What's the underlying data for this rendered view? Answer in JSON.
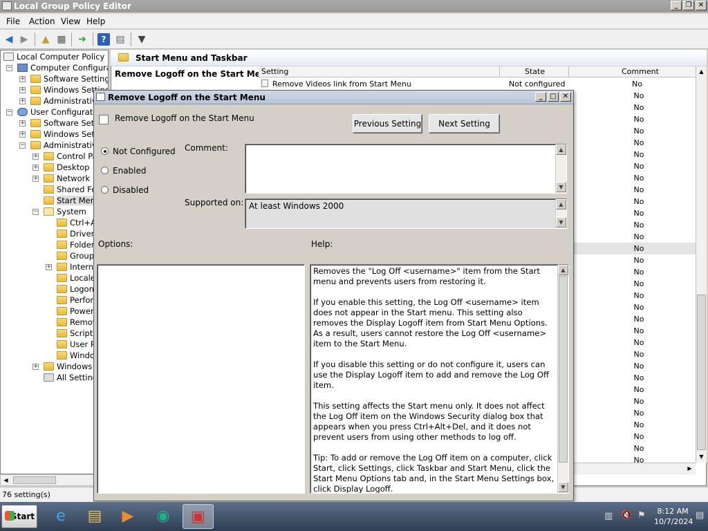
{
  "window": {
    "title": "Local Group Policy Editor"
  },
  "menu": [
    "File",
    "Action",
    "View",
    "Help"
  ],
  "tree": {
    "items": [
      {
        "label": "Local Computer Policy",
        "level": 0
      },
      {
        "label": "Computer Configuratio",
        "level": 1
      },
      {
        "label": "Software Settings",
        "level": 2
      },
      {
        "label": "Windows Settings",
        "level": 2
      },
      {
        "label": "Administrative",
        "level": 2
      },
      {
        "label": "User Configuration",
        "level": 1
      },
      {
        "label": "Software Setti",
        "level": 2
      },
      {
        "label": "Windows Setti",
        "level": 2
      },
      {
        "label": "Administrative",
        "level": 2
      },
      {
        "label": "Control Pa",
        "level": 3
      },
      {
        "label": "Desktop",
        "level": 3
      },
      {
        "label": "Network",
        "level": 3
      },
      {
        "label": "Shared Fo",
        "level": 3
      },
      {
        "label": "Start Menu",
        "level": 3
      },
      {
        "label": "System",
        "level": 3
      },
      {
        "label": "Ctrl+A",
        "level": 4
      },
      {
        "label": "Driver",
        "level": 4
      },
      {
        "label": "Folder",
        "level": 4
      },
      {
        "label": "Group",
        "level": 4
      },
      {
        "label": "Intern",
        "level": 4
      },
      {
        "label": "Locale",
        "level": 4
      },
      {
        "label": "Logon",
        "level": 4
      },
      {
        "label": "Perfor",
        "level": 4
      },
      {
        "label": "Power",
        "level": 4
      },
      {
        "label": "Remov",
        "level": 4
      },
      {
        "label": "Scripts",
        "level": 4
      },
      {
        "label": "User P",
        "level": 4
      },
      {
        "label": "Windo",
        "level": 4
      },
      {
        "label": "Windows C",
        "level": 3
      },
      {
        "label": "All Settings",
        "level": 3
      }
    ]
  },
  "right": {
    "folder_title": "Start Menu and Taskbar",
    "selected_policy": "Remove Logoff on the Start Menu",
    "columns": {
      "setting": "Setting",
      "state": "State",
      "comment": "Comment"
    },
    "first_row": {
      "setting": "Remove Videos link from Start Menu",
      "state": "Not configured",
      "comment": "No"
    },
    "comments": [
      "No",
      "No",
      "No",
      "No",
      "No",
      "No",
      "No",
      "No",
      "No",
      "No",
      "No",
      "No",
      "No",
      "No",
      "No",
      "No",
      "No",
      "No",
      "No",
      "No",
      "No",
      "No",
      "No",
      "No",
      "No",
      "No",
      "No",
      "No",
      "No",
      "No",
      "No",
      "No"
    ]
  },
  "status": {
    "text": "76 setting(s)"
  },
  "dialog": {
    "title": "Remove Logoff on the Start Menu",
    "policy_name": "Remove Logoff on the Start Menu",
    "prev_button": "Previous Setting",
    "next_button": "Next Setting",
    "radios": {
      "not_configured": "Not Configured",
      "enabled": "Enabled",
      "disabled": "Disabled"
    },
    "selected": "not_configured",
    "comment_label": "Comment:",
    "comment_value": "",
    "supported_label": "Supported on:",
    "supported_value": "At least Windows 2000",
    "options_label": "Options:",
    "help_label": "Help:",
    "help_paragraphs": [
      "Removes the \"Log Off <username>\" item from the Start menu and prevents users from restoring it.",
      "If you enable this setting, the Log Off <username> item does not appear in the Start menu. This setting also removes the Display Logoff item from Start Menu Options. As a result, users cannot restore the Log Off <username> item to the Start Menu.",
      "If you disable this setting or do not configure it, users can use the Display Logoff item to add and remove the Log Off item.",
      "This setting affects the Start menu only. It does not affect the Log Off item on the Windows Security dialog box that appears when you press Ctrl+Alt+Del, and it does not prevent users from using other methods to log off.",
      "Tip: To add or remove the Log Off item on a computer, click Start, click Settings, click Taskbar and Start Menu, click the Start Menu Options tab and, in the Start Menu Settings box, click Display Logoff."
    ]
  },
  "taskbar": {
    "start_label": "Start",
    "apps": [
      "internet-explorer-icon",
      "explorer-icon",
      "media-player-icon",
      "windows-icon",
      "group-policy-toolbox-icon"
    ],
    "time": "8:12 AM",
    "date": "10/7/2024"
  }
}
